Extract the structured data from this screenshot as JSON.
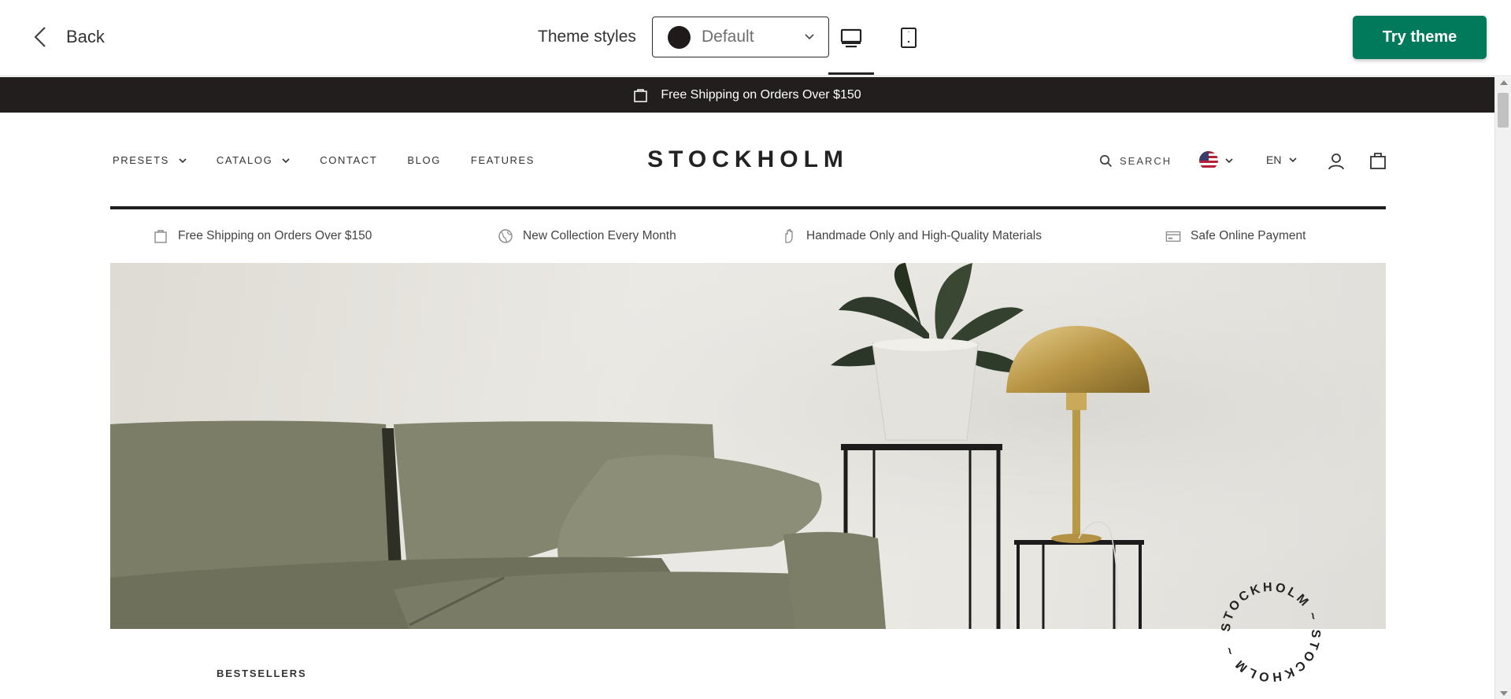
{
  "toolbar": {
    "back_label": "Back",
    "theme_styles_label": "Theme styles",
    "theme_select_value": "Default",
    "view_options": [
      "desktop-view",
      "mobile-view"
    ],
    "try_theme_label": "Try theme",
    "accent_color": "#007a5a"
  },
  "announcement": {
    "text": "Free Shipping on Orders Over $150",
    "background": "#221e1e"
  },
  "store": {
    "logo": "STOCKHOLM",
    "nav": [
      {
        "label": "PRESETS",
        "has_dropdown": true
      },
      {
        "label": "CATALOG",
        "has_dropdown": true
      },
      {
        "label": "CONTACT",
        "has_dropdown": false
      },
      {
        "label": "BLOG",
        "has_dropdown": false
      },
      {
        "label": "FEATURES",
        "has_dropdown": false
      }
    ],
    "search_label": "SEARCH",
    "country_icon": "us-flag-icon",
    "language": "EN"
  },
  "features": [
    {
      "icon": "bag-icon",
      "text": "Free Shipping on Orders Over $150"
    },
    {
      "icon": "globe-icon",
      "text": "New Collection Every Month"
    },
    {
      "icon": "hand-icon",
      "text": "Handmade Only and High-Quality Materials"
    },
    {
      "icon": "card-icon",
      "text": "Safe Online Payment"
    }
  ],
  "hero": {
    "badge_text": "STOCKHOLM ~ STOCKHOLM ~ "
  },
  "sections": {
    "bestsellers_label": "BESTSELLERS"
  }
}
